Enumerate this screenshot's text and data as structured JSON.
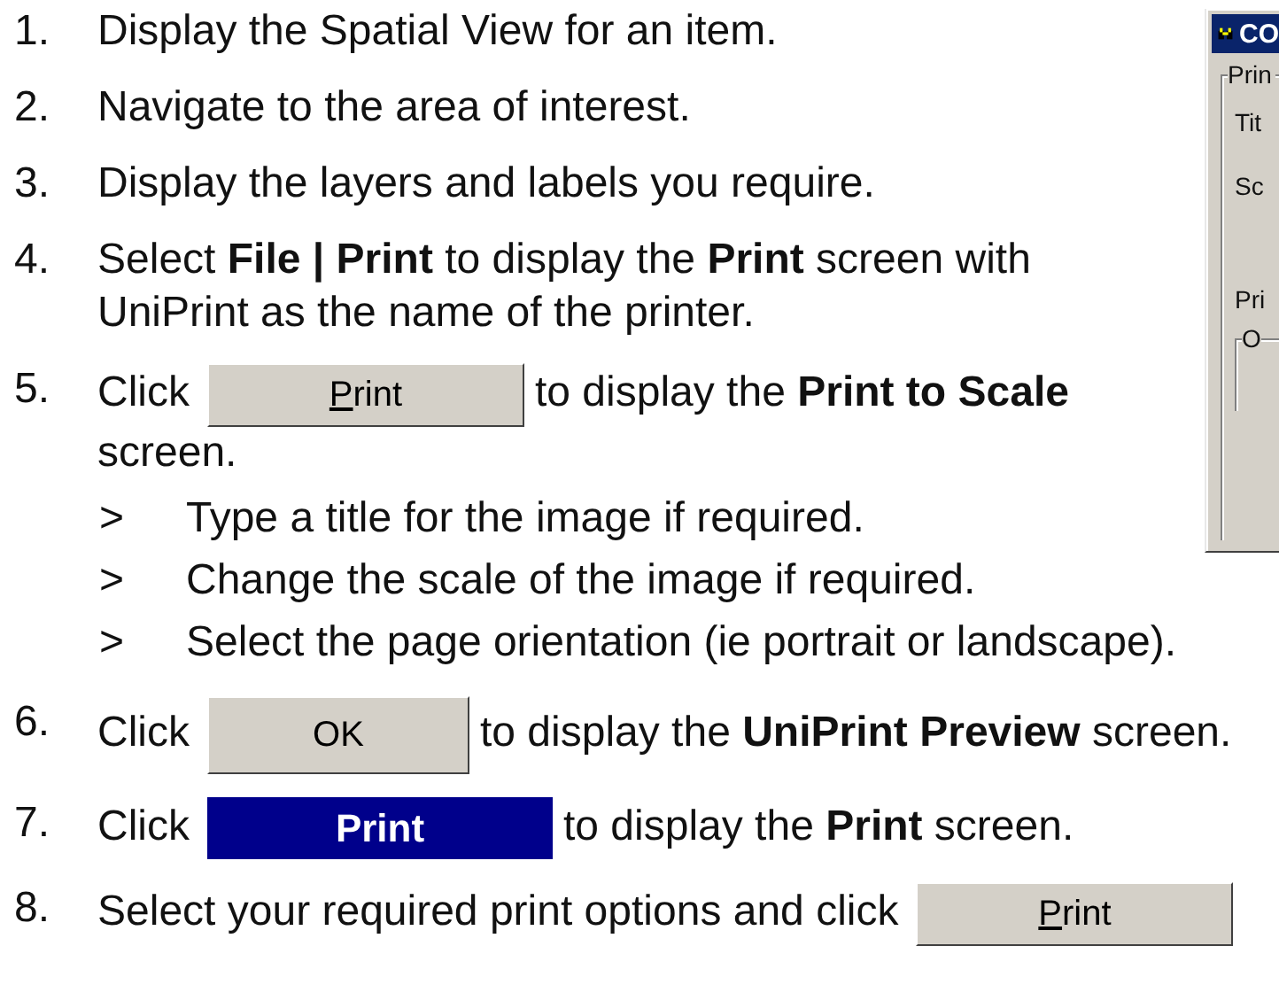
{
  "dialog": {
    "title": "CO",
    "group_label": "Prin",
    "fields": [
      "Tit",
      "Sc",
      "Pri"
    ],
    "inner_group_label": "O"
  },
  "steps": [
    {
      "number": "1.",
      "parts": [
        {
          "kind": "text",
          "text": "Display the Spatial View for an item."
        }
      ]
    },
    {
      "number": "2.",
      "parts": [
        {
          "kind": "text",
          "text": "Navigate to the area of interest."
        }
      ]
    },
    {
      "number": "3.",
      "parts": [
        {
          "kind": "text",
          "text": "Display the layers and labels you require."
        }
      ]
    },
    {
      "number": "4.",
      "parts": [
        {
          "kind": "text",
          "text": "Select **File | Print** to display the **Print** screen with UniPrint as the name of the printer."
        }
      ]
    },
    {
      "number": "5.",
      "parts": [
        {
          "kind": "text",
          "text": "Click"
        },
        {
          "kind": "button",
          "text": "Print",
          "underline_first": true
        },
        {
          "kind": "text",
          "text": "to display the **Print to Scale**"
        },
        {
          "kind": "text",
          "text": "screen."
        }
      ],
      "substeps": [
        {
          "marker": ">",
          "text": "Type a title for the image if required."
        },
        {
          "marker": ">",
          "text": "Change the scale of the image if required."
        },
        {
          "marker": ">",
          "text": "Select the page orientation (ie portrait or landscape)."
        }
      ]
    },
    {
      "number": "6.",
      "parts": [
        {
          "kind": "text",
          "text": "Click"
        },
        {
          "kind": "button",
          "text": "OK",
          "underline_first": false
        },
        {
          "kind": "text",
          "text": "to display the **UniPrint Preview** screen."
        }
      ]
    },
    {
      "number": "7.",
      "parts": [
        {
          "kind": "text",
          "text": "Click"
        },
        {
          "kind": "highlight-button",
          "text": "Print"
        },
        {
          "kind": "text",
          "text": "to display the **Print** screen."
        }
      ]
    },
    {
      "number": "8.",
      "parts": [
        {
          "kind": "text",
          "text": "Select your required print options and click"
        },
        {
          "kind": "button",
          "text": "Print",
          "underline_first": true
        }
      ]
    }
  ]
}
